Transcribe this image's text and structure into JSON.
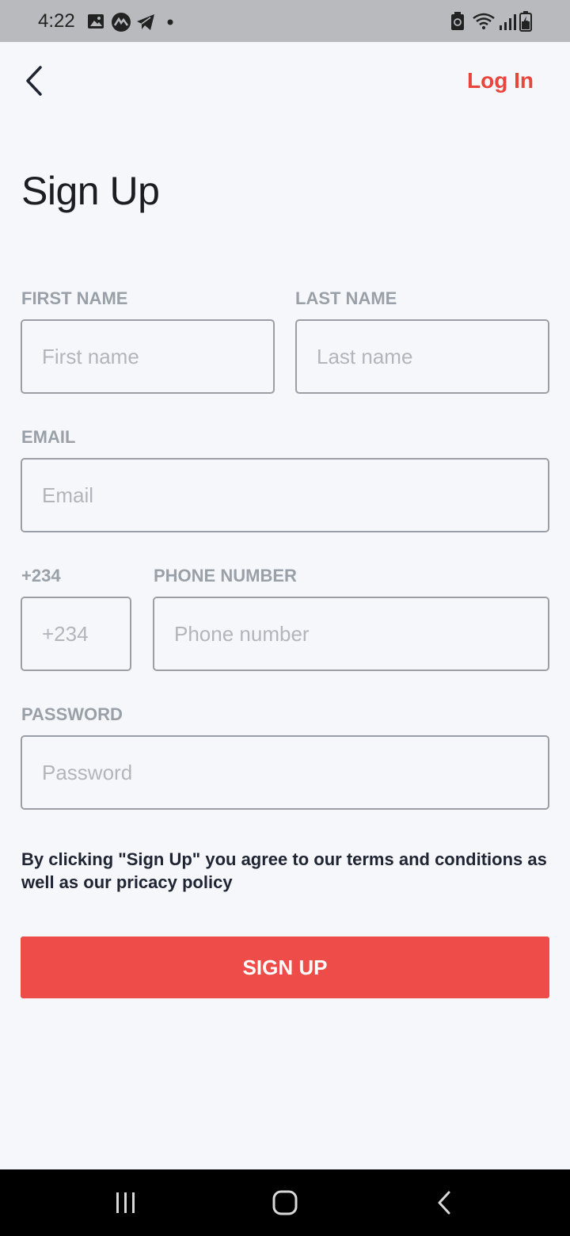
{
  "status_bar": {
    "time": "4:22",
    "left_icons": [
      "gallery-icon",
      "app-icon",
      "telegram-icon",
      "notification-dot-icon"
    ],
    "right_icons": [
      "battery-saver-icon",
      "wifi-icon",
      "signal-icon",
      "battery-charging-icon"
    ]
  },
  "header": {
    "back_icon": "chevron-left-icon",
    "login_label": "Log In"
  },
  "page": {
    "title": "Sign Up"
  },
  "form": {
    "first_name": {
      "label": "FIRST NAME",
      "placeholder": "First name",
      "value": ""
    },
    "last_name": {
      "label": "LAST NAME",
      "placeholder": "Last name",
      "value": ""
    },
    "email": {
      "label": "EMAIL",
      "placeholder": "Email",
      "value": ""
    },
    "country_code": {
      "label": "+234",
      "placeholder": "+234",
      "value": ""
    },
    "phone": {
      "label": "PHONE NUMBER",
      "placeholder": "Phone number",
      "value": ""
    },
    "password": {
      "label": "PASSWORD",
      "placeholder": "Password",
      "value": ""
    }
  },
  "terms_text": "By clicking \"Sign Up\" you agree to our terms and conditions as well as our pricacy policy",
  "submit_label": "SIGN UP",
  "colors": {
    "accent": "#e8453c",
    "button": "#ee4c48",
    "background": "#f6f7fb",
    "label": "#9aa0a8"
  },
  "nav_bar": {
    "buttons": [
      "recent-apps-icon",
      "home-icon",
      "back-icon"
    ]
  }
}
